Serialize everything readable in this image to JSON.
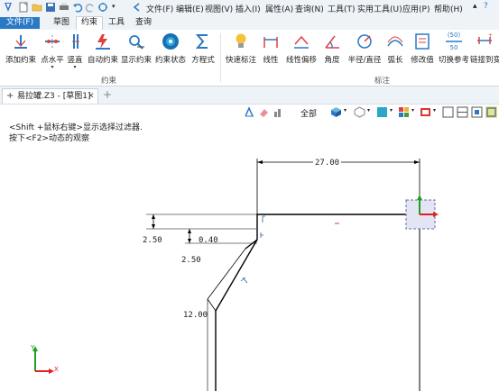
{
  "menu": {
    "items": [
      "文件(F)",
      "编辑(E)",
      "视图(V)",
      "插入(I)",
      "属性(A)",
      "查询(N)",
      "工具(T)",
      "实用工具(U)",
      "应用(P)",
      "帮助(H)"
    ]
  },
  "ribbon_tabs": [
    "文件(F)",
    "草图",
    "约束",
    "工具",
    "查询"
  ],
  "ribbon": {
    "buttons": [
      "添加约束",
      "点水平",
      "竖直",
      "自动约束",
      "显示约束",
      "约束状态",
      "方程式",
      "快速标注",
      "线性",
      "线性偏移",
      "角度",
      "半径/直径",
      "弧长",
      "修改值",
      "切换参考",
      "链接到变"
    ],
    "groups": [
      "约束",
      "标注"
    ],
    "badge_top": "(50)",
    "badge_bottom": "50"
  },
  "document": {
    "tab_title": "易拉罐.Z3 - [草图1]",
    "add_tab": "+"
  },
  "view_toolbar": {
    "filter": "全部"
  },
  "hints": {
    "line1": "<Shift +鼠标右键>显示选择过滤器.",
    "line2": "按下<F2>动态的观察"
  },
  "dimensions": {
    "d_27": "27.00",
    "d_2_50_a": "2.50",
    "d_0_40": "0.40",
    "d_2_50_b": "2.50",
    "d_12": "12.00"
  },
  "axes": {
    "x": "X",
    "y": "Y"
  },
  "colors": {
    "accent": "#2b78c5",
    "sketch_line": "#000000",
    "axis_x": "#e02020",
    "axis_y": "#20a020"
  }
}
